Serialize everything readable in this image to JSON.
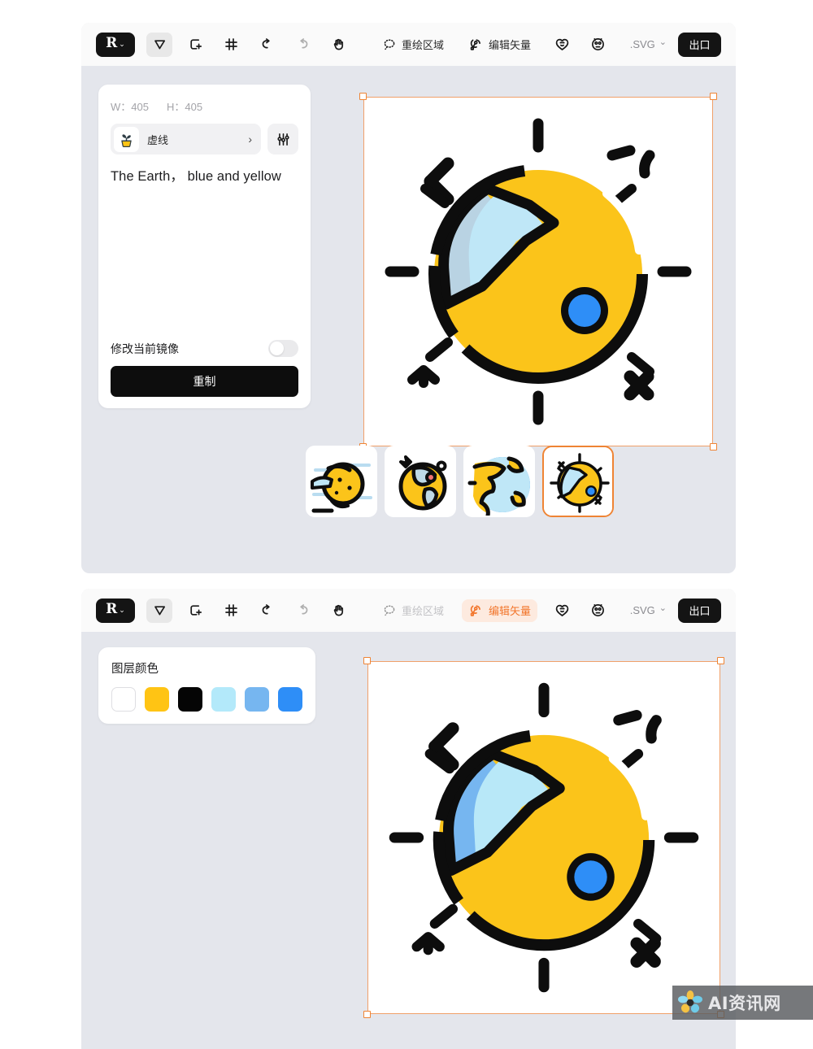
{
  "accent": {
    "orange": "#ef8434",
    "orange_soft_bg": "#fdeadf",
    "black": "#141414",
    "workspace_bg": "#e4e6ec",
    "toolbar_bg": "#fafafa"
  },
  "toolbar": {
    "logo_glyph": "R",
    "logo_caret": "⌄",
    "tools": [
      {
        "name": "select-tool",
        "icon": "cursor-arrow-icon",
        "state": "active"
      },
      {
        "name": "add-shape-tool",
        "icon": "add-shape-icon",
        "state": "normal"
      },
      {
        "name": "crop-tool",
        "icon": "crop-frame-icon",
        "state": "normal"
      },
      {
        "name": "undo-tool",
        "icon": "undo-arrow-icon",
        "state": "normal"
      },
      {
        "name": "redo-tool",
        "icon": "redo-arrow-icon",
        "state": "disabled"
      },
      {
        "name": "pan-tool",
        "icon": "hand-icon",
        "state": "normal"
      }
    ],
    "redraw_region_label": "重绘区域",
    "edit_vector_label": "编辑矢量",
    "format_label": ".SVG",
    "format_caret": "⌄",
    "export_label": "出口"
  },
  "panel": {
    "width_label": "W：405",
    "height_label": "H：405",
    "preset_label": "虚线",
    "preset_chevron": "›",
    "prompt_text": "The Earth， blue and yellow",
    "toggle_label": "修改当前镜像",
    "toggle_state": "off",
    "regenerate_label": "重制"
  },
  "colors_panel": {
    "title": "图层颜色",
    "swatches": [
      {
        "name": "swatch-white",
        "hex": "#ffffff"
      },
      {
        "name": "swatch-yellow",
        "hex": "#ffc414"
      },
      {
        "name": "swatch-black",
        "hex": "#050505"
      },
      {
        "name": "swatch-light-cyan",
        "hex": "#b3e9fa"
      },
      {
        "name": "swatch-sky-blue",
        "hex": "#76b6f0"
      },
      {
        "name": "swatch-blue",
        "hex": "#2e8ef7"
      }
    ]
  },
  "artwork": {
    "title": "earth-sun-illustration",
    "top_variant": {
      "body_color": "#fbc41a",
      "continent_color": "#bfe7f7",
      "continent_shade": "#b9d3e3",
      "dot_color": "#2e8ef7",
      "outline_color": "#0d0d0d",
      "shine_color": "#ffffff"
    },
    "bottom_variant": {
      "body_color": "#fbc41a",
      "continent_color": "#b8e8f8",
      "continent_shade": "#76b6f0",
      "dot_color": "#2e8ef7",
      "outline_color": "#0d0d0d",
      "shine_color": "#ffffff"
    }
  },
  "thumbnails": [
    {
      "name": "thumb-variant-1",
      "selected": false
    },
    {
      "name": "thumb-variant-2",
      "selected": false
    },
    {
      "name": "thumb-variant-3",
      "selected": false
    },
    {
      "name": "thumb-variant-4",
      "selected": true
    }
  ],
  "watermark": {
    "text": "AI资讯网"
  }
}
